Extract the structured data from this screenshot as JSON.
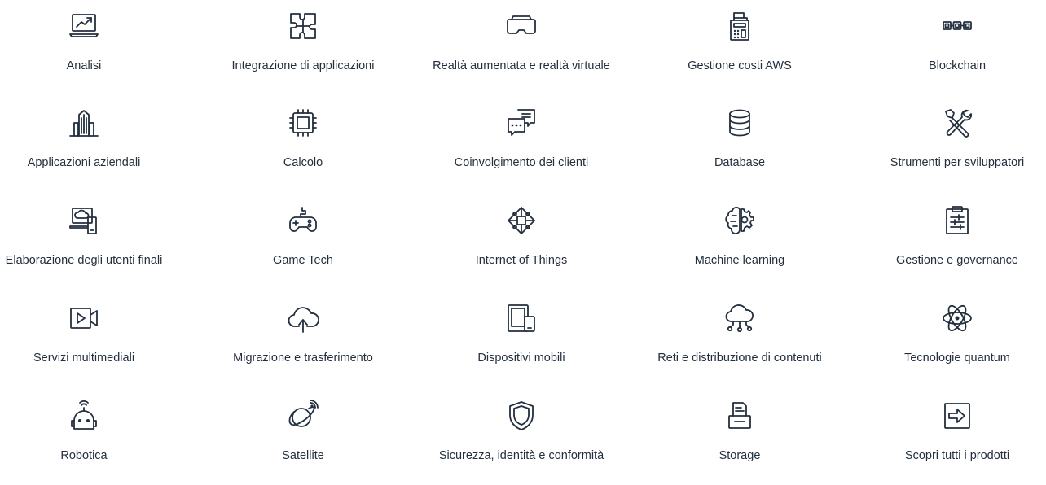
{
  "categories": [
    {
      "label": "Analisi",
      "icon": "analytics-icon"
    },
    {
      "label": "Integrazione di applicazioni",
      "icon": "puzzle-icon"
    },
    {
      "label": "Realtà aumentata e realtà virtuale",
      "icon": "vr-headset-icon"
    },
    {
      "label": "Gestione costi AWS",
      "icon": "cash-register-icon"
    },
    {
      "label": "Blockchain",
      "icon": "blockchain-icon"
    },
    {
      "label": "Applicazioni aziendali",
      "icon": "city-buildings-icon"
    },
    {
      "label": "Calcolo",
      "icon": "chip-icon"
    },
    {
      "label": "Coinvolgimento dei clienti",
      "icon": "chat-bubbles-icon"
    },
    {
      "label": "Database",
      "icon": "database-icon"
    },
    {
      "label": "Strumenti per sviluppatori",
      "icon": "tools-icon"
    },
    {
      "label": "Elaborazione degli utenti finali",
      "icon": "desktop-devices-icon"
    },
    {
      "label": "Game Tech",
      "icon": "gamepad-icon"
    },
    {
      "label": "Internet of Things",
      "icon": "iot-chip-icon"
    },
    {
      "label": "Machine learning",
      "icon": "brain-gear-icon"
    },
    {
      "label": "Gestione e governance",
      "icon": "clipboard-icon"
    },
    {
      "label": "Servizi multimediali",
      "icon": "video-camera-icon"
    },
    {
      "label": "Migrazione e trasferimento",
      "icon": "cloud-upload-icon"
    },
    {
      "label": "Dispositivi mobili",
      "icon": "tablet-phone-icon"
    },
    {
      "label": "Reti e distribuzione di contenuti",
      "icon": "cloud-network-icon"
    },
    {
      "label": "Tecnologie quantum",
      "icon": "atom-icon"
    },
    {
      "label": "Robotica",
      "icon": "robot-icon"
    },
    {
      "label": "Satellite",
      "icon": "satellite-planet-icon"
    },
    {
      "label": "Sicurezza, identità e conformità",
      "icon": "shield-icon"
    },
    {
      "label": "Storage",
      "icon": "storage-printer-icon"
    },
    {
      "label": "Scopri tutti i prodotti",
      "icon": "arrow-right-box-icon"
    }
  ],
  "colors": {
    "icon_stroke": "#232f3e",
    "text": "#232f3e",
    "background": "#ffffff"
  }
}
